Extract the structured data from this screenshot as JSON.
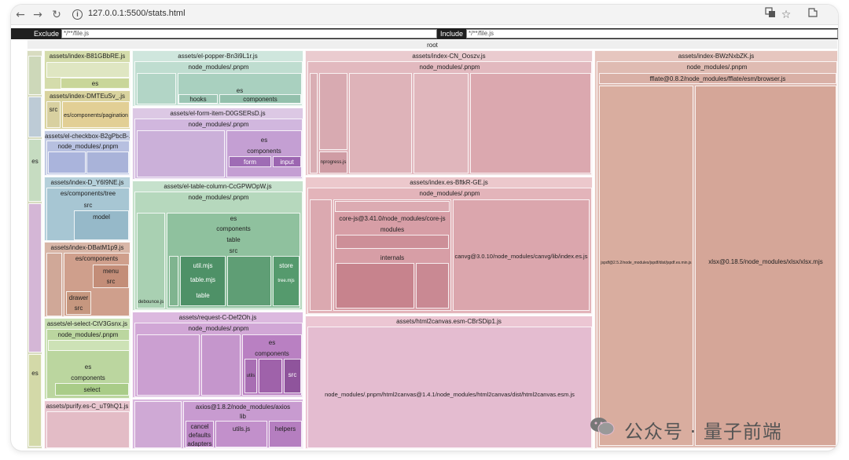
{
  "browser": {
    "url": "127.0.0.1:5500/stats.html",
    "icons": [
      "back-icon",
      "forward-icon",
      "reload-icon",
      "info-icon",
      "translate-icon",
      "star-icon",
      "extensions-icon"
    ]
  },
  "filters": {
    "exclude_label": "Exclude",
    "exclude_value": "*/**/file.js",
    "include_label": "Include",
    "include_value": "*/**/file.js"
  },
  "treemap": {
    "root": "root",
    "col2": {
      "popper": "assets/el-popper-Bn3i9L1r.js",
      "popper_pnpm": "node_modules/.pnpm",
      "popper_es": "es",
      "popper_hooks": "hooks",
      "popper_components": "components",
      "form_item": "assets/el-form-item-D0GSERsD.js",
      "form_pnpm": "node_modules/.pnpm",
      "form_es": "es",
      "form_components": "components",
      "form_form": "form",
      "form_input": "input",
      "table_column": "assets/el-table-column-CcGPWOpW.js",
      "table_pnpm": "node_modules/.pnpm",
      "table_es": "es",
      "table_components": "components",
      "table_table": "table",
      "table_src": "src",
      "table_util": "util.mjs",
      "table_store": "store",
      "table_tablemjs": "table.mjs",
      "table_treemjs": "tree.mjs",
      "table_table2": "table",
      "table_debounce": "debounce.js",
      "request": "assets/request-C-Def2Oh.js",
      "request_pnpm": "node_modules/.pnpm",
      "request_es": "es",
      "request_components": "components",
      "request_utils": "utils",
      "request_src": "src",
      "axios": "axios@1.8.2/node_modules/axios",
      "axios_lib": "lib",
      "axios_cancel": "cancel",
      "axios_utils": "utils.js",
      "axios_helpers": "helpers",
      "axios_defaults": "defaults",
      "axios_adapters": "adapters"
    },
    "col1": {
      "b81": "assets/index-B81GBbRE.js",
      "b81_es": "es",
      "dmt": "assets/index-DMTEuSv_.js",
      "dmt_src": "src",
      "dmt_pagination": "es/components/pagination",
      "checkbox": "assets/el-checkbox-B2gPbcB-.js",
      "checkbox_pnpm": "node_modules/.pnpm",
      "d_y6": "assets/index-D_Y6I9NE.js",
      "d_y6_tree": "es/components/tree",
      "d_y6_src": "src",
      "d_y6_model": "model",
      "dbat": "assets/index-DBatM1p9.js",
      "dbat_components": "es/components",
      "dbat_menu": "menu",
      "dbat_src": "src",
      "dbat_drawer": "drawer",
      "dbat_src2": "src",
      "select": "assets/el-select-CtV3Gsnx.js",
      "select_pnpm": "node_modules/.pnpm",
      "select_es": "es",
      "select_components": "components",
      "select_select": "select",
      "purify": "assets/purify.es-C_uT9hQ1.js",
      "side_es1": "es",
      "side_es2": "es"
    },
    "col3": {
      "cn": "assets/index-CN_Ooszv.js",
      "cn_pnpm": "node_modules/.pnpm",
      "cn_nprogress": "nprogress.js",
      "es": "assets/index.es-BftkR-GE.js",
      "es_pnpm": "node_modules/.pnpm",
      "corejs": "core-js@3.41.0/node_modules/core-js",
      "modules": "modules",
      "internals": "internals",
      "canvg": "canvg@3.0.10/node_modules/canvg/lib/index.es.js",
      "h2c": "assets/html2canvas.esm-CBrSDip1.js",
      "h2c_path": "node_modules/.pnpm/html2canvas@1.4.1/node_modules/html2canvas/dist/html2canvas.esm.js"
    },
    "col4": {
      "bwz": "assets/index-BWzNxbZK.js",
      "bwz_pnpm": "node_modules/.pnpm",
      "fflate": "fflate@0.8.2/node_modules/fflate/esm/browser.js",
      "jspdf": "jspdf@2.5.2/node_modules/jspdf/dist/jspdf.es.min.js",
      "xlsx": "xlsx@0.18.5/node_modules/xlsx/xlsx.mjs"
    }
  },
  "watermark": {
    "text": "公众号 · 量子前端",
    "icon": "wechat-icon"
  },
  "colors": {
    "green": "#cfe3c7",
    "teal": "#bfdcd0",
    "pink": "#e3bfc0",
    "tan": "#d9b3a3",
    "purple": "#d3b3d8",
    "olive": "#d2d8a8",
    "blue": "#b9cfd8"
  }
}
